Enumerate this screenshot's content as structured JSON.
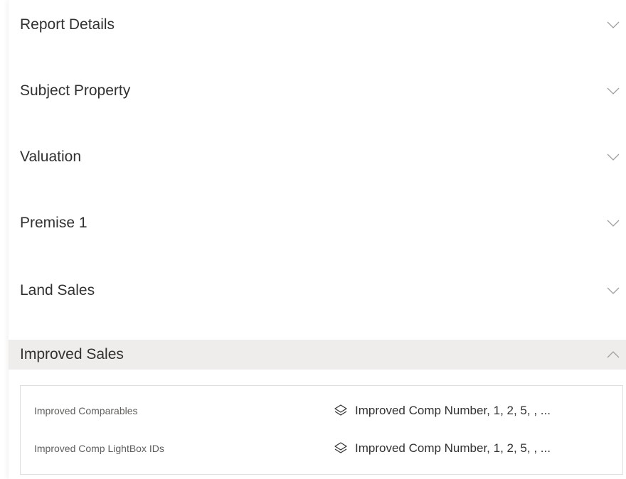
{
  "sections": [
    {
      "label": "Report Details",
      "expanded": false
    },
    {
      "label": "Subject Property",
      "expanded": false
    },
    {
      "label": "Valuation",
      "expanded": false
    },
    {
      "label": "Premise 1",
      "expanded": false
    },
    {
      "label": "Land Sales",
      "expanded": false
    },
    {
      "label": "Improved Sales",
      "expanded": true
    }
  ],
  "improved_sales": {
    "fields": [
      {
        "label": "Improved Comparables",
        "value": "Improved Comp Number, 1, 2, 5, , ...",
        "icon": "layers-icon"
      },
      {
        "label": "Improved Comp LightBox IDs",
        "value": "Improved Comp Number, 1, 2, 5, , ...",
        "icon": "layers-icon"
      }
    ]
  },
  "colors": {
    "expanded_header_bg": "#efedeb",
    "text": "#323130",
    "label_text": "#605e5c",
    "chevron": "#a19f9d",
    "border": "#e1dfdd"
  }
}
